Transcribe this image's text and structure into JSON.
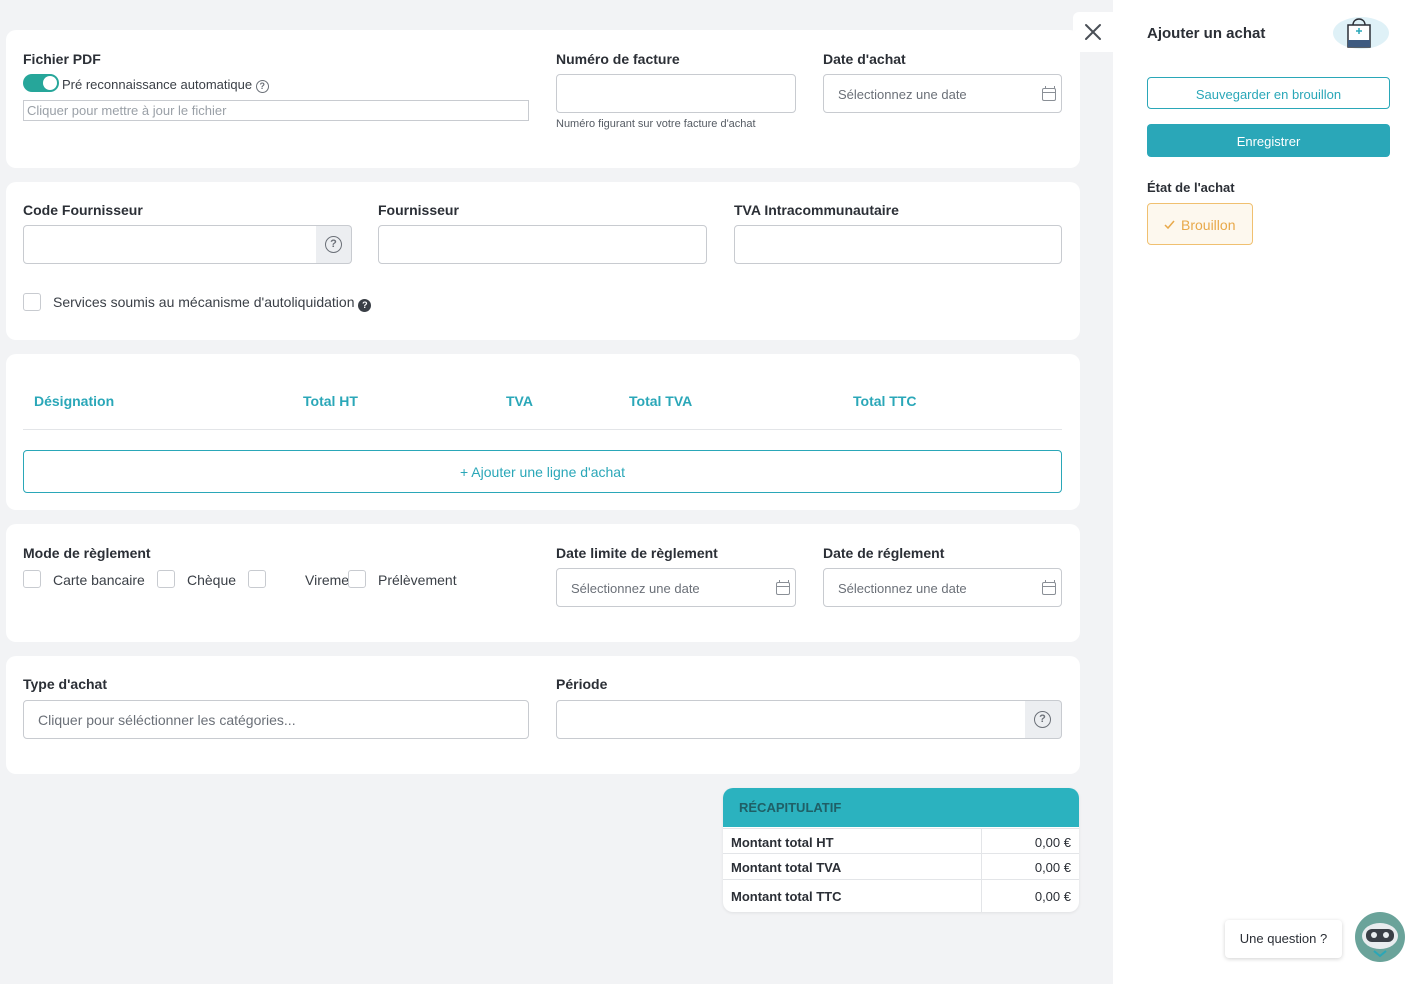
{
  "pdf": {
    "label": "Fichier PDF",
    "toggle_label": "Pré reconnaissance automatique",
    "file_placeholder": "Cliquer pour mettre à jour le fichier"
  },
  "invoice": {
    "label": "Numéro de facture",
    "help": "Numéro figurant sur votre facture d'achat"
  },
  "purchase_date": {
    "label": "Date d'achat",
    "placeholder": "Sélectionnez une date"
  },
  "supplier": {
    "code_label": "Code Fournisseur",
    "name_label": "Fournisseur",
    "vat_label": "TVA Intracommunautaire",
    "reverse_charge_label": "Services soumis au mécanisme d'autoliquidation"
  },
  "lines": {
    "headers": [
      "Désignation",
      "Total HT",
      "TVA",
      "Total TVA",
      "Total TTC"
    ],
    "add_button": "+ Ajouter une ligne d'achat"
  },
  "payment": {
    "mode_label": "Mode de règlement",
    "modes": [
      "Carte bancaire",
      "Chèque",
      "Virement",
      "Prélèvement"
    ],
    "deadline_label": "Date limite de règlement",
    "deadline_placeholder": "Sélectionnez une date",
    "date_label": "Date de réglement",
    "date_placeholder": "Sélectionnez une date"
  },
  "category": {
    "type_label": "Type d'achat",
    "type_placeholder": "Cliquer pour séléctionner les catégories...",
    "period_label": "Période"
  },
  "recap": {
    "title": "RÉCAPITULATIF",
    "rows": [
      {
        "key": "Montant total HT",
        "value": "0,00 €"
      },
      {
        "key": "Montant total TVA",
        "value": "0,00 €"
      },
      {
        "key": "Montant total TTC",
        "value": "0,00 €"
      }
    ]
  },
  "side": {
    "title": "Ajouter un achat",
    "draft_button": "Sauvegarder en brouillon",
    "save_button": "Enregistrer",
    "state_label": "État de l'achat",
    "state_badge": "Brouillon"
  },
  "chat": {
    "question": "Une question ?"
  },
  "colors": {
    "accent": "#2aa7b8",
    "toggle": "#26a69a",
    "draft": "#e8a94a"
  },
  "icons": [
    "close-icon",
    "calendar-icon",
    "help-icon",
    "check-icon",
    "shopping-bag-icon",
    "robot-avatar-icon"
  ]
}
